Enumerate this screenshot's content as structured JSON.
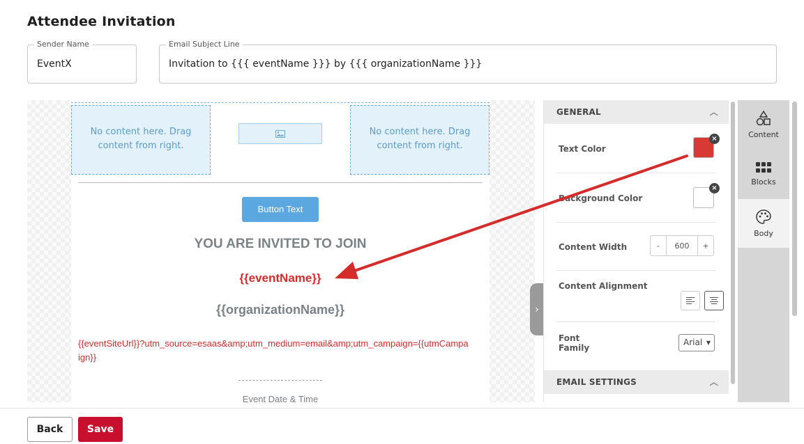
{
  "page": {
    "title": "Attendee Invitation"
  },
  "form": {
    "sender_name": {
      "label": "Sender Name",
      "value": "EventX"
    },
    "subject": {
      "label": "Email Subject Line",
      "value": "Invitation to {{{ eventName }}} by {{{ organizationName }}}"
    }
  },
  "email": {
    "placeholder_text": "No content here. Drag content from right.",
    "button_text": "Button Text",
    "invited_heading": "YOU ARE INVITED TO JOIN",
    "event_name": "{{eventName}}",
    "organization_name": "{{organizationName}}",
    "site_url": "{{eventSiteUrl}}?utm_source=esaas&amp;utm_medium=email&amp;utm_campaign={{utmCampaign}}",
    "date_label": "Event Date & Time"
  },
  "panel": {
    "general_title": "GENERAL",
    "email_settings_title": "EMAIL SETTINGS",
    "text_color_label": "Text Color",
    "text_color": "#d63a33",
    "background_color_label": "Background Color",
    "background_color": "#ffffff",
    "content_width_label": "Content Width",
    "content_width": "600",
    "minus": "-",
    "plus": "+",
    "content_alignment_label": "Content Alignment",
    "font_family_label": "Font Family",
    "font_family_value": "Arial"
  },
  "tabs": [
    {
      "label": "Content",
      "icon": "shapes-icon"
    },
    {
      "label": "Blocks",
      "icon": "grid-icon"
    },
    {
      "label": "Body",
      "icon": "palette-icon"
    }
  ],
  "footer": {
    "back_label": "Back",
    "save_label": "Save"
  },
  "colors": {
    "accent_red": "#c8102e",
    "annotation_red": "#d42b2b",
    "button_blue": "#5ba8e0"
  }
}
